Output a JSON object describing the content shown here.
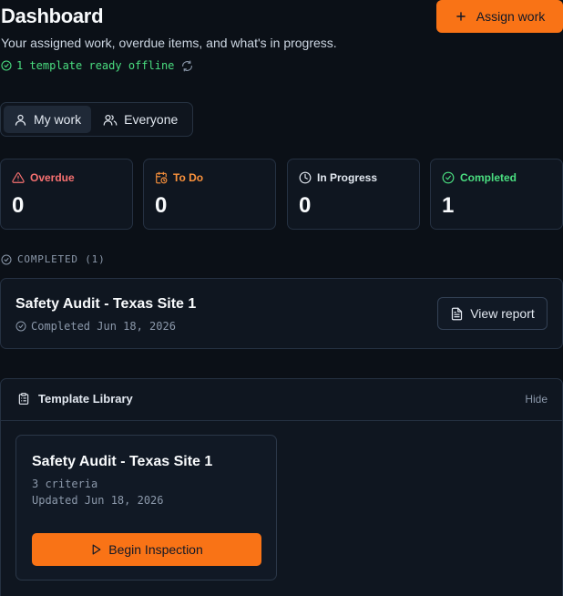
{
  "header": {
    "title": "Dashboard",
    "subtitle": "Your assigned work, overdue items, and what's in progress.",
    "offline_status": "1 template ready offline",
    "assign_label": "Assign work"
  },
  "scope": {
    "tabs": [
      {
        "label": "My work",
        "icon": "user-icon",
        "active": true
      },
      {
        "label": "Everyone",
        "icon": "users-icon",
        "active": false
      }
    ]
  },
  "stats": [
    {
      "label": "Overdue",
      "value": "0",
      "color": "#f87171",
      "icon": "alert-triangle-icon"
    },
    {
      "label": "To Do",
      "value": "0",
      "color": "#fb923c",
      "icon": "calendar-clock-icon"
    },
    {
      "label": "In Progress",
      "value": "0",
      "color": "#e2e8f0",
      "icon": "clock-icon"
    },
    {
      "label": "Completed",
      "value": "1",
      "color": "#4ade80",
      "icon": "check-circle-icon"
    }
  ],
  "completed_section": {
    "label": "COMPLETED (1)",
    "items": [
      {
        "title": "Safety Audit - Texas Site 1",
        "meta": "Completed Jun 18, 2026",
        "action": "View report"
      }
    ]
  },
  "template_library": {
    "title": "Template Library",
    "hide_label": "Hide",
    "templates": [
      {
        "name": "Safety Audit - Texas Site 1",
        "criteria": "3 criteria",
        "updated": "Updated Jun 18, 2026",
        "action": "Begin Inspection"
      }
    ]
  },
  "colors": {
    "accent": "#f97316",
    "background": "#0b1017",
    "card": "#0f1620",
    "success": "#4ade80",
    "danger": "#f87171"
  }
}
